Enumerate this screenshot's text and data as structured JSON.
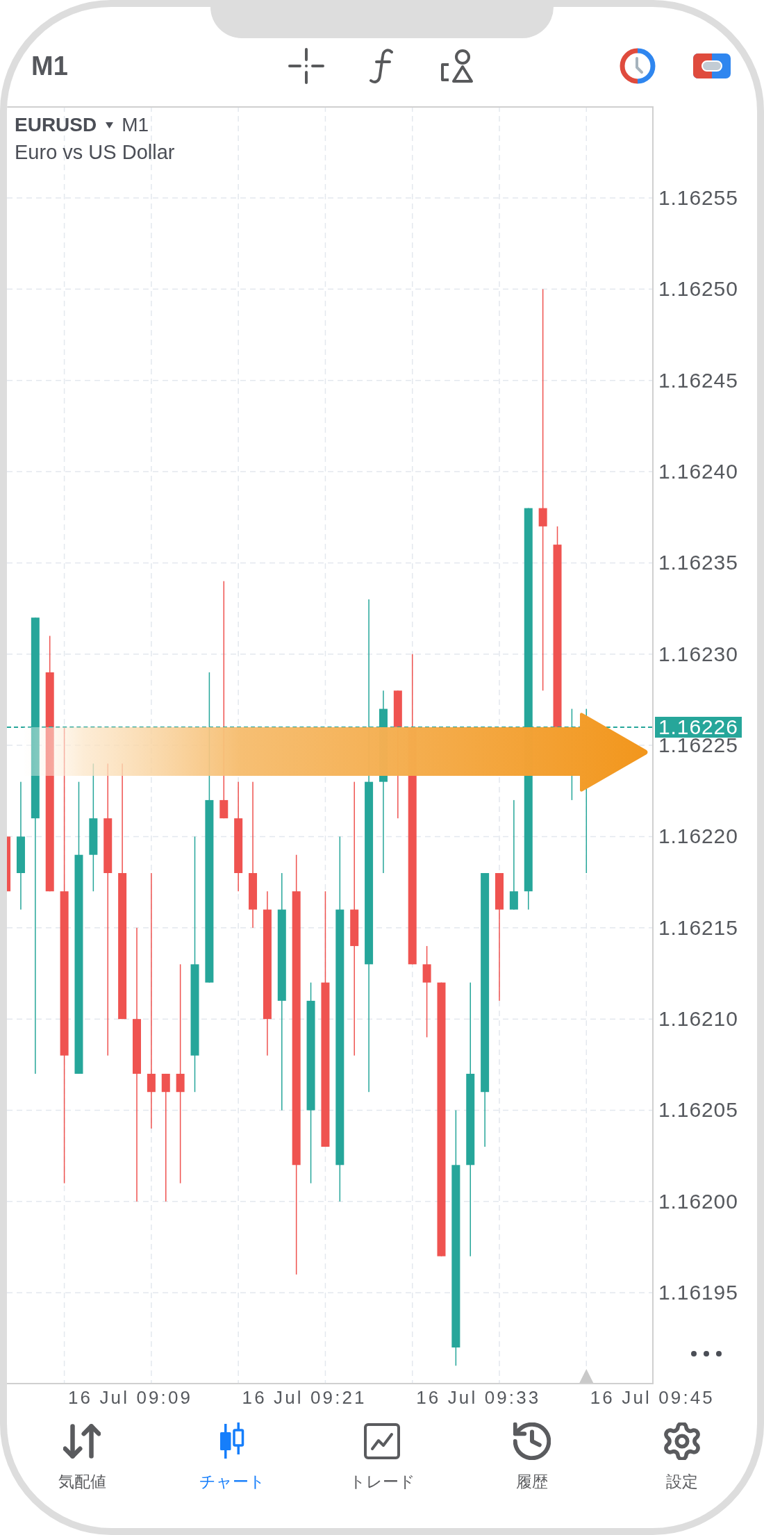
{
  "top_bar": {
    "timeframe": "M1"
  },
  "chart": {
    "symbol": "EURUSD",
    "timeframe": "M1",
    "description": "Euro vs US Dollar",
    "price_labels": [
      "1.16255",
      "1.16250",
      "1.16245",
      "1.16240",
      "1.16235",
      "1.16230",
      "1.16225",
      "1.16220",
      "1.16215",
      "1.16210",
      "1.16205",
      "1.16200",
      "1.16195"
    ],
    "current_price": "1.16226",
    "time_labels": [
      "16 Jul 09:09",
      "16 Jul 09:21",
      "16 Jul 09:33",
      "16 Jul 09:45"
    ]
  },
  "tab_bar": {
    "tabs": [
      {
        "label": "気配値",
        "selected": false
      },
      {
        "label": "チャート",
        "selected": true
      },
      {
        "label": "トレード",
        "selected": false
      },
      {
        "label": "履歴",
        "selected": false
      },
      {
        "label": "設定",
        "selected": false
      }
    ]
  }
}
